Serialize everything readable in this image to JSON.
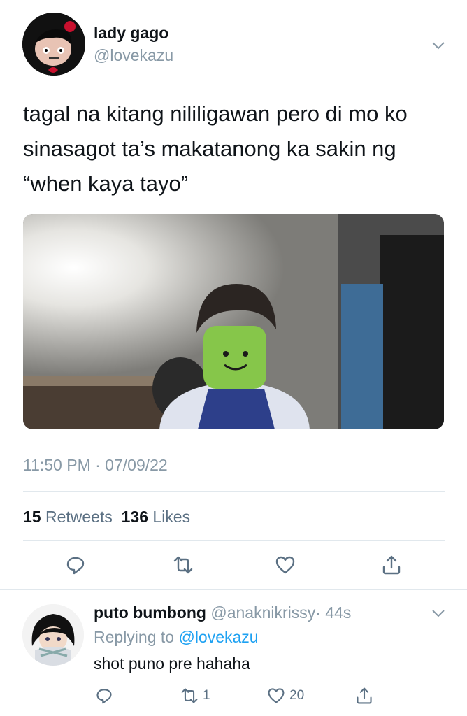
{
  "tweet": {
    "author": {
      "display_name": "lady gago",
      "handle": "@lovekazu"
    },
    "text": "tagal na kitang nililigawan pero di mo ko sinasagot ta’s makatanong ka sakin ng “when kaya tayo”",
    "timestamp": "11:50 PM · 07/09/22",
    "stats": {
      "retweets_count": "15",
      "retweets_label": "Retweets",
      "likes_count": "136",
      "likes_label": "Likes"
    },
    "icons": [
      "chevron-down-icon",
      "reply-icon",
      "retweet-icon",
      "like-icon",
      "share-icon"
    ]
  },
  "reply": {
    "author": {
      "display_name": "puto bumbong",
      "handle": "@anaknikrissy",
      "time": "· 44s"
    },
    "replying_prefix": "Replying to",
    "replying_handle": "@lovekazu",
    "text": "shot puno pre hahaha",
    "actions": {
      "retweets": "1",
      "likes": "20"
    }
  },
  "colors": {
    "link": "#1da1f2",
    "muted": "#8899a6",
    "text": "#0f1419",
    "divider": "#e1e8ed"
  }
}
